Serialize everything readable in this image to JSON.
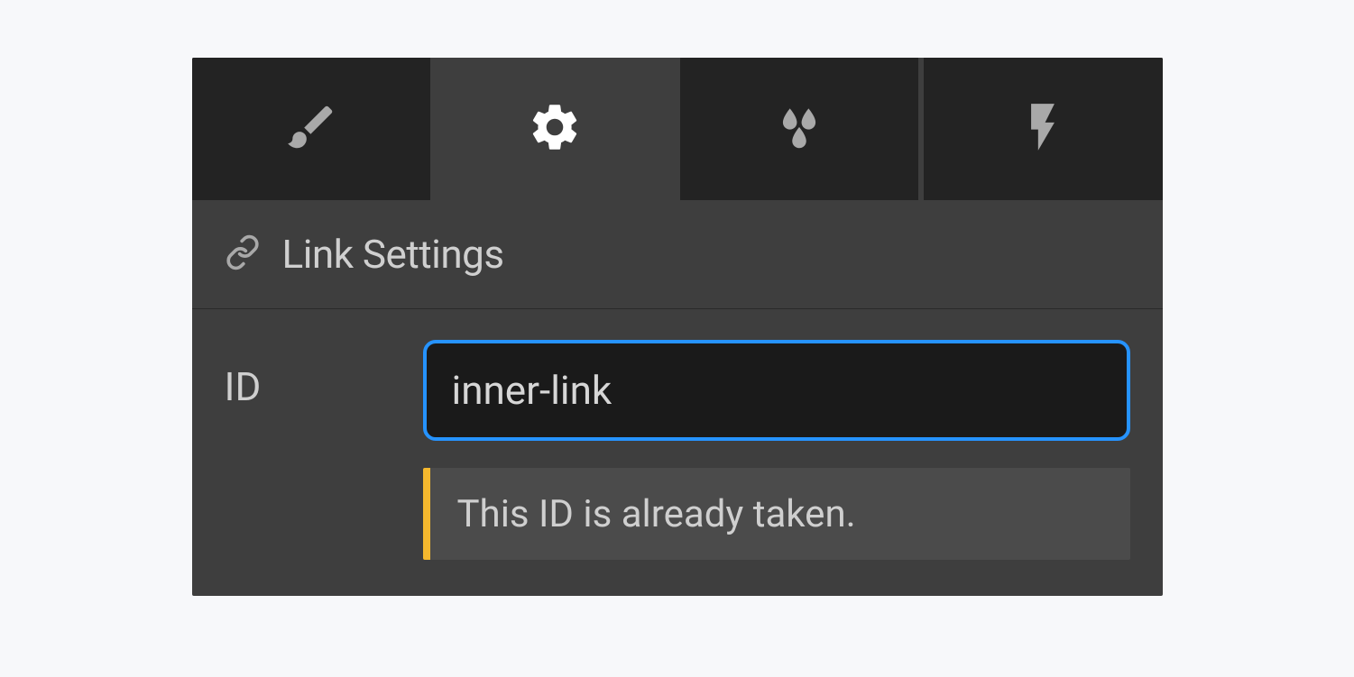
{
  "tabs": [
    {
      "name": "style",
      "icon": "brush"
    },
    {
      "name": "settings",
      "icon": "gear",
      "active": true
    },
    {
      "name": "effects",
      "icon": "drops"
    },
    {
      "name": "interactions",
      "icon": "bolt"
    }
  ],
  "section": {
    "title": "Link Settings",
    "icon": "link"
  },
  "field": {
    "label": "ID",
    "value": "inner-link",
    "warning": "This ID is already taken."
  }
}
